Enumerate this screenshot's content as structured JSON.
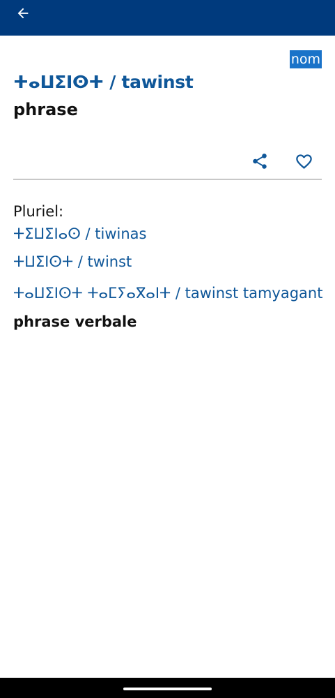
{
  "header": {
    "back_icon": "arrow-left-icon"
  },
  "entry": {
    "part_of_speech": "nom",
    "headword": "ⵜⴰⵡⵉⵏⵙⵜ / tawinst",
    "gloss": "phrase",
    "actions": {
      "share_icon": "share-icon",
      "favorite_icon": "heart-outline-icon"
    },
    "plural_label": "Pluriel:",
    "plurals": [
      "ⵜⵉⵡⵉⵏⴰⵙ / tiwinas",
      "ⵜⵡⵉⵏⵙⵜ / twinst"
    ],
    "related": {
      "term": "ⵜⴰⵡⵉⵏⵙⵜ ⵜⴰⵎⵢⴰⴳⴰⵏⵜ / tawinst tamyagant",
      "gloss": "phrase verbale"
    }
  },
  "colors": {
    "app_bar": "#003a7d",
    "accent_blue": "#0f5799",
    "badge_blue": "#1a73c9"
  }
}
